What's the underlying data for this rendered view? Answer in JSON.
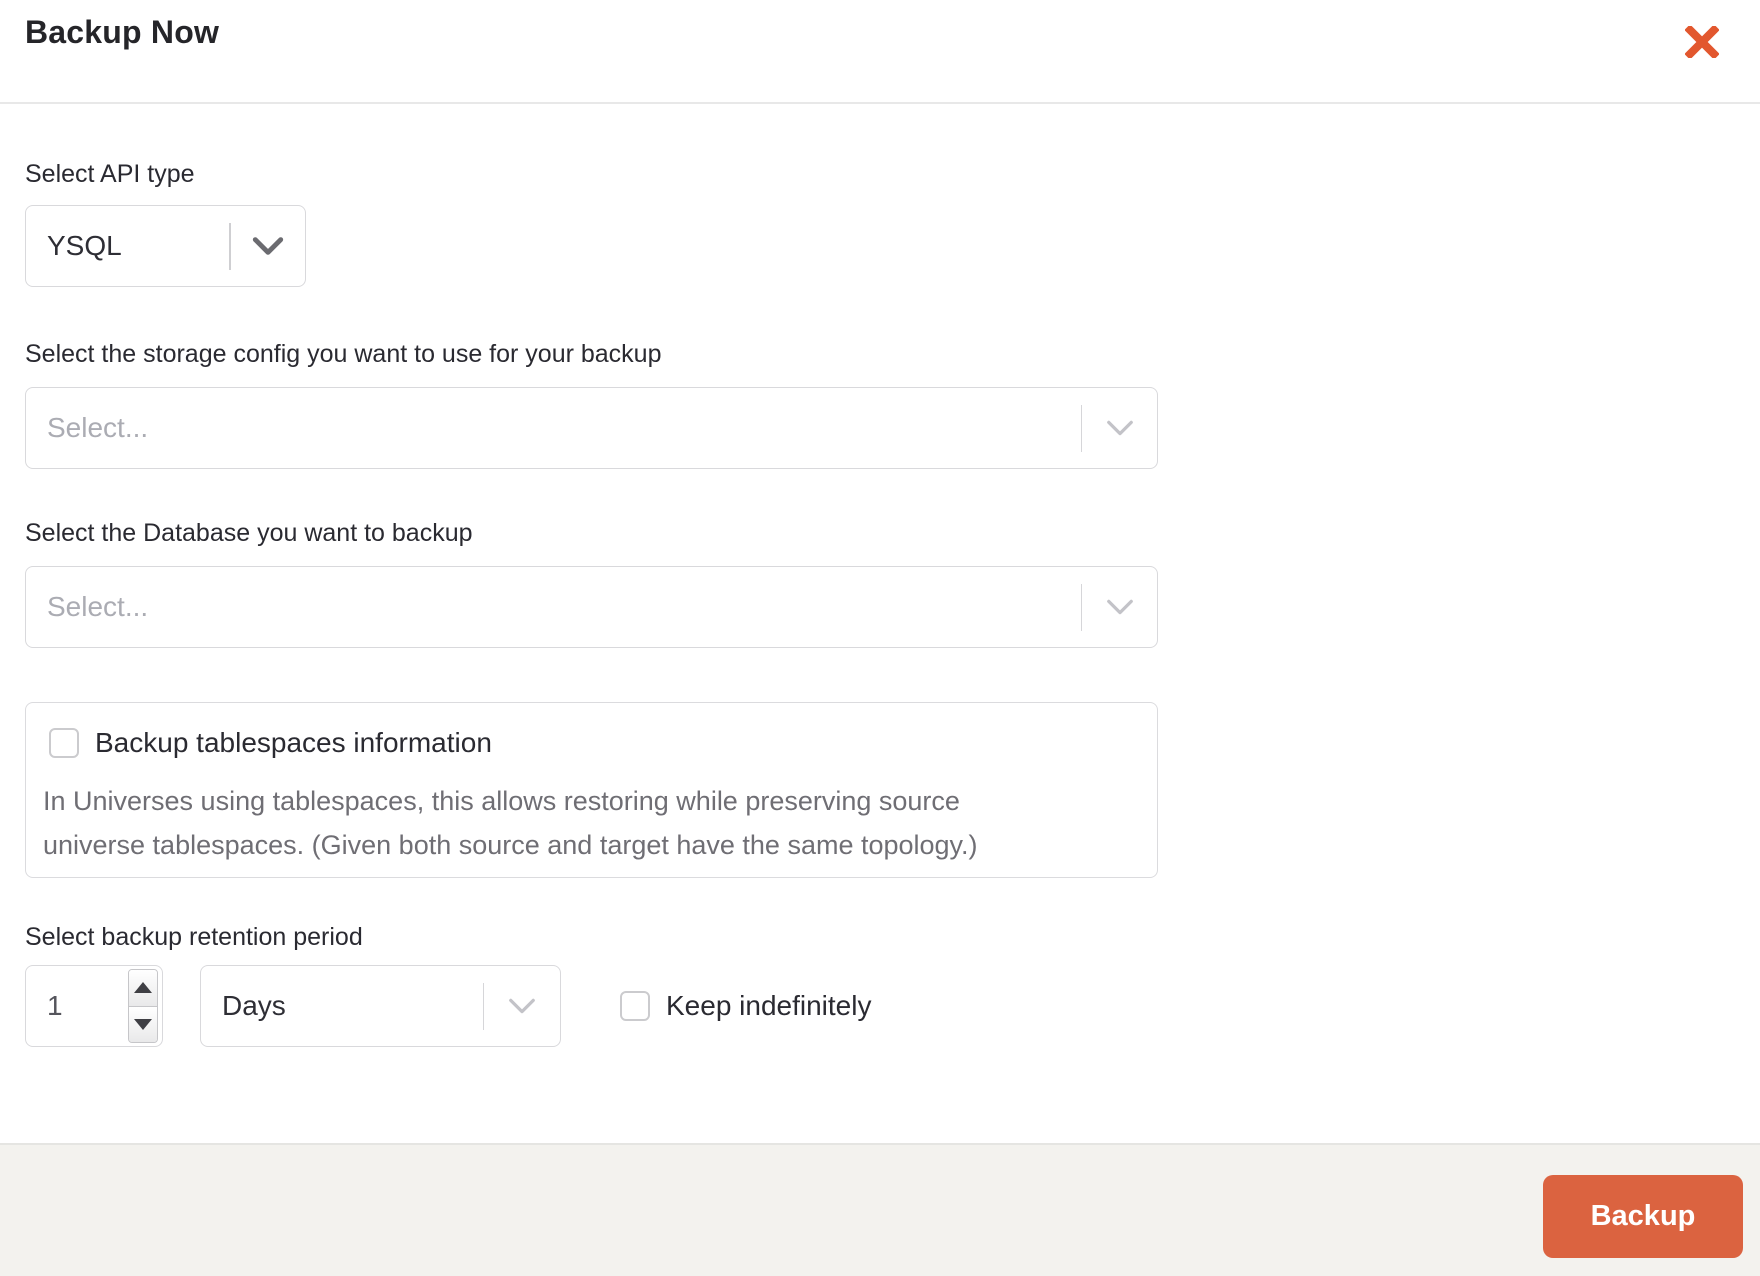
{
  "modal": {
    "title": "Backup Now"
  },
  "form": {
    "api_type": {
      "label": "Select API type",
      "value": "YSQL"
    },
    "storage_config": {
      "label": "Select the storage config you want to use for your backup",
      "placeholder": "Select..."
    },
    "database": {
      "label": "Select the Database you want to backup",
      "placeholder": "Select..."
    },
    "tablespaces": {
      "label": "Backup tablespaces information",
      "description": "In Universes using tablespaces, this allows restoring while preserving source universe tablespaces. (Given both source and target have the same topology.)",
      "checked": false
    },
    "retention": {
      "label": "Select backup retention period",
      "value": "1",
      "unit": "Days",
      "keep_label": "Keep indefinitely",
      "keep_checked": false
    }
  },
  "footer": {
    "backup_label": "Backup"
  },
  "icons": {
    "close": "✕",
    "chevron_down": "⌄",
    "spinner_up": "▲",
    "spinner_down": "▼"
  },
  "colors": {
    "accent_orange": "#db6340",
    "close_orange": "#e2572e",
    "footer_bg": "#f3f2ee",
    "border_gray": "#d9d9dc",
    "placeholder_gray": "#abacb3"
  }
}
